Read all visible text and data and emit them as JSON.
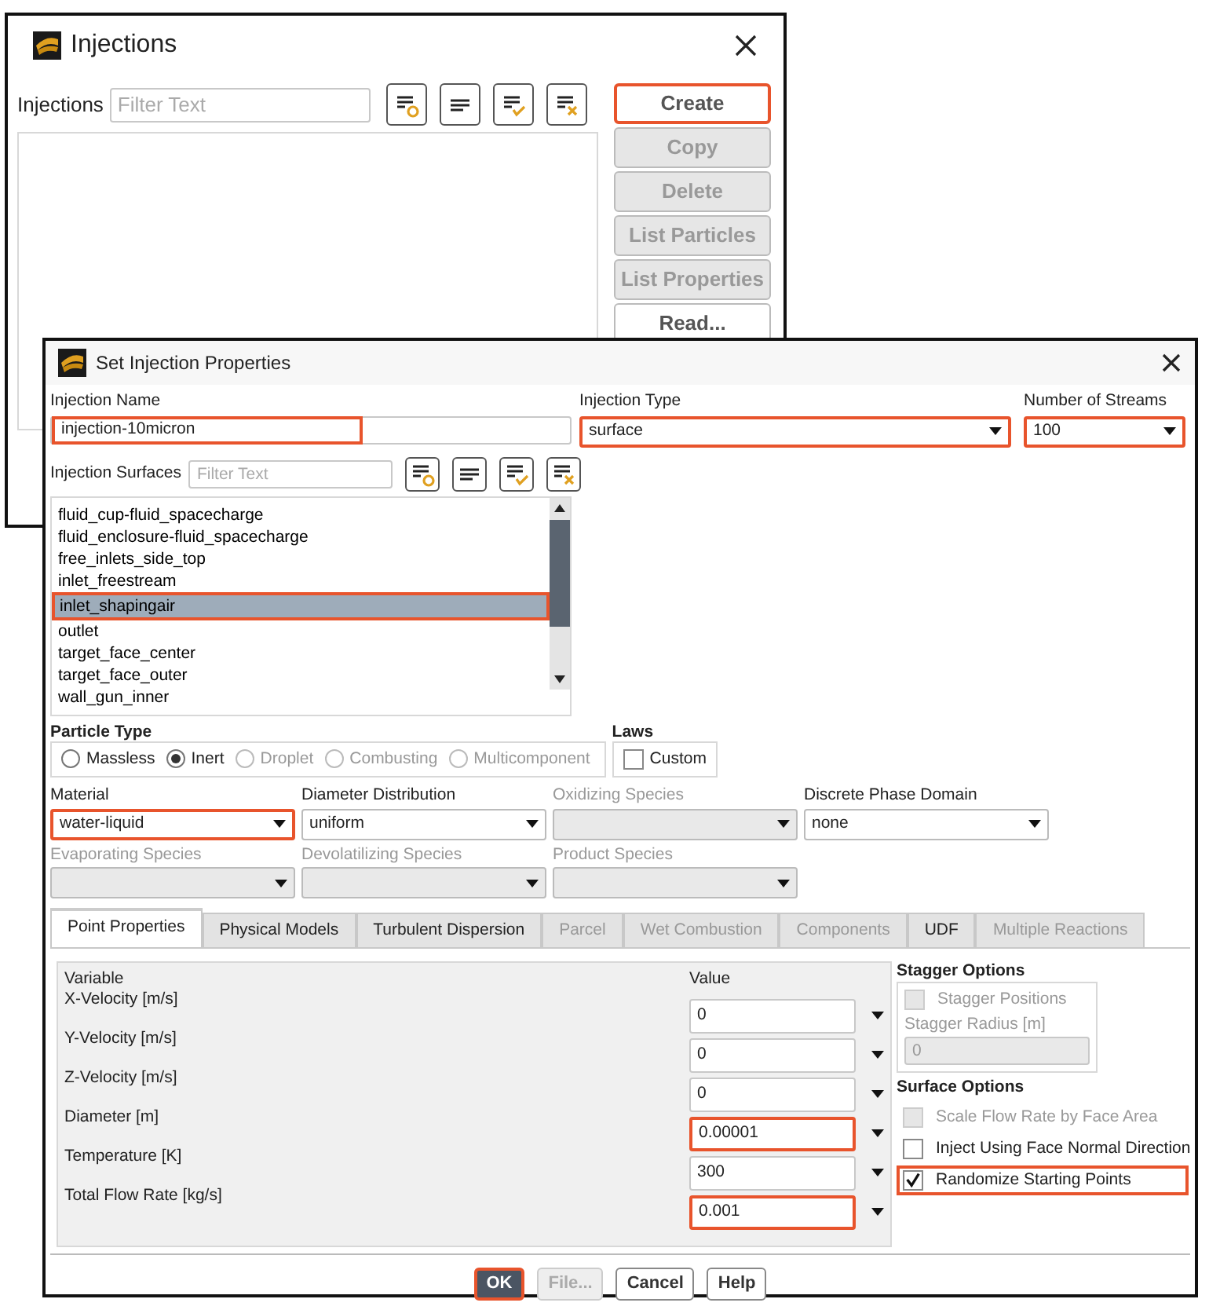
{
  "injections_window": {
    "title": "Injections",
    "filter_label": "Injections",
    "filter": {
      "placeholder": "Filter Text"
    },
    "buttons": [
      {
        "label": "Create",
        "disabled": false,
        "highlighted": true
      },
      {
        "label": "Copy",
        "disabled": true,
        "highlighted": false
      },
      {
        "label": "Delete",
        "disabled": true,
        "highlighted": false
      },
      {
        "label": "List Particles",
        "disabled": true,
        "highlighted": false
      },
      {
        "label": "List Properties",
        "disabled": true,
        "highlighted": false
      },
      {
        "label": "Read...",
        "disabled": false,
        "highlighted": false
      }
    ]
  },
  "properties_window": {
    "title": "Set Injection Properties",
    "injection_name": {
      "label": "Injection Name",
      "value": "injection-10micron",
      "highlighted": true
    },
    "injection_type": {
      "label": "Injection Type",
      "value": "surface",
      "highlighted": true
    },
    "number_of_streams": {
      "label": "Number of Streams",
      "value": "100",
      "highlighted": true
    },
    "surfaces": {
      "label": "Injection Surfaces",
      "filter": {
        "placeholder": "Filter Text"
      },
      "items": [
        {
          "label": "fluid_cup-fluid_spacecharge",
          "selected": false,
          "highlighted": false
        },
        {
          "label": "fluid_enclosure-fluid_spacecharge",
          "selected": false,
          "highlighted": false
        },
        {
          "label": "free_inlets_side_top",
          "selected": false,
          "highlighted": false
        },
        {
          "label": "inlet_freestream",
          "selected": false,
          "highlighted": false
        },
        {
          "label": "inlet_shapingair",
          "selected": true,
          "highlighted": true
        },
        {
          "label": "outlet",
          "selected": false,
          "highlighted": false
        },
        {
          "label": "target_face_center",
          "selected": false,
          "highlighted": false
        },
        {
          "label": "target_face_outer",
          "selected": false,
          "highlighted": false
        },
        {
          "label": "wall_gun_inner",
          "selected": false,
          "highlighted": false
        }
      ]
    },
    "particle_type": {
      "label": "Particle Type",
      "options": [
        {
          "label": "Massless",
          "selected": false,
          "disabled": false
        },
        {
          "label": "Inert",
          "selected": true,
          "disabled": false
        },
        {
          "label": "Droplet",
          "selected": false,
          "disabled": true
        },
        {
          "label": "Combusting",
          "selected": false,
          "disabled": true
        },
        {
          "label": "Multicomponent",
          "selected": false,
          "disabled": true
        }
      ]
    },
    "laws": {
      "label": "Laws",
      "options": [
        {
          "label": "Custom",
          "checked": false
        }
      ]
    },
    "dropdowns": [
      {
        "label": "Material",
        "value": "water-liquid",
        "disabled": false,
        "highlighted": true
      },
      {
        "label": "Diameter Distribution",
        "value": "uniform",
        "disabled": false,
        "highlighted": false
      },
      {
        "label": "Oxidizing Species",
        "disabled": true,
        "highlighted": false
      },
      {
        "label": "Discrete Phase Domain",
        "value": "none",
        "disabled": false,
        "highlighted": false
      },
      {
        "label": "Evaporating Species",
        "disabled": true,
        "highlighted": false
      },
      {
        "label": "Devolatilizing Species",
        "disabled": true,
        "highlighted": false
      },
      {
        "label": "Product Species",
        "disabled": true,
        "highlighted": false
      }
    ],
    "tabs": [
      {
        "label": "Point Properties",
        "selected": true,
        "disabled": false
      },
      {
        "label": "Physical Models",
        "selected": false,
        "disabled": false
      },
      {
        "label": "Turbulent Dispersion",
        "selected": false,
        "disabled": false
      },
      {
        "label": "Parcel",
        "selected": false,
        "disabled": true
      },
      {
        "label": "Wet Combustion",
        "selected": false,
        "disabled": true
      },
      {
        "label": "Components",
        "selected": false,
        "disabled": true
      },
      {
        "label": "UDF",
        "selected": false,
        "disabled": false
      },
      {
        "label": "Multiple Reactions",
        "selected": false,
        "disabled": true
      }
    ],
    "variables": {
      "columns": [
        "Variable",
        "Value"
      ],
      "rows": [
        {
          "name": "X-Velocity [m/s]",
          "value": "0",
          "highlighted": false
        },
        {
          "name": "Y-Velocity [m/s]",
          "value": "0",
          "highlighted": false
        },
        {
          "name": "Z-Velocity [m/s]",
          "value": "0",
          "highlighted": false
        },
        {
          "name": "Diameter [m]",
          "value": "0.00001",
          "highlighted": true
        },
        {
          "name": "Temperature [K]",
          "value": "300",
          "highlighted": false
        },
        {
          "name": "Total Flow Rate [kg/s]",
          "value": "0.001",
          "highlighted": true
        }
      ]
    },
    "stagger_options": {
      "title": "Stagger Options",
      "checkbox": {
        "label": "Stagger Positions",
        "checked": false,
        "disabled": true
      },
      "radius": {
        "label": "Stagger Radius [m]",
        "value": "0",
        "disabled": true
      }
    },
    "surface_options": {
      "title": "Surface Options",
      "options": [
        {
          "label": "Scale Flow Rate by Face Area",
          "checked": false,
          "disabled": true,
          "highlighted": false
        },
        {
          "label": "Inject Using Face Normal Direction",
          "checked": false,
          "disabled": false,
          "highlighted": false
        },
        {
          "label": "Randomize Starting Points",
          "checked": true,
          "disabled": false,
          "highlighted": true
        }
      ]
    },
    "footer_buttons": [
      {
        "label": "OK",
        "kind": "default",
        "disabled": false,
        "highlighted": true
      },
      {
        "label": "File...",
        "kind": "normal",
        "disabled": true,
        "highlighted": false
      },
      {
        "label": "Cancel",
        "kind": "normal",
        "disabled": false,
        "highlighted": false
      },
      {
        "label": "Help",
        "kind": "normal",
        "disabled": false,
        "highlighted": false
      }
    ]
  }
}
